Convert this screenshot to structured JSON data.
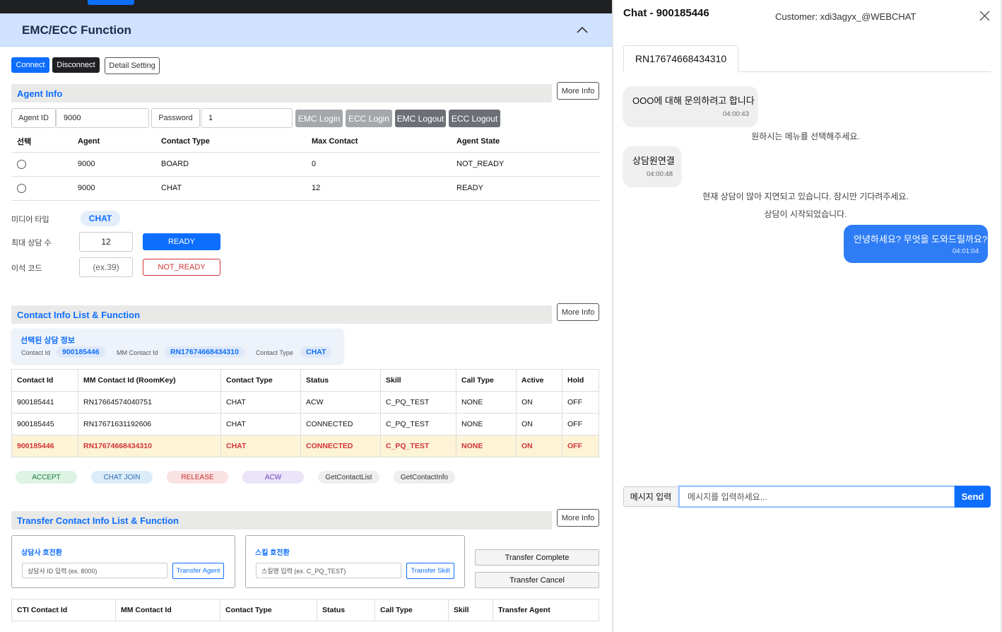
{
  "header": {
    "title": "EMC/ECC Function"
  },
  "connection": {
    "connect": "Connect",
    "disconnect": "Disconnect",
    "detail_setting": "Detail Setting"
  },
  "more_info": "More Info",
  "agent_info": {
    "title": "Agent Info",
    "agent_id_label": "Agent ID",
    "agent_id_value": "9000",
    "password_label": "Password",
    "password_value": "1",
    "buttons": {
      "emc_login": "EMC Login",
      "ecc_login": "ECC Login",
      "emc_logout": "EMC Logout",
      "ecc_logout": "ECC Logout"
    },
    "columns": [
      "선택",
      "Agent",
      "Contact Type",
      "Max Contact",
      "Agent State"
    ],
    "rows": [
      {
        "agent": "9000",
        "contact_type": "BOARD",
        "max_contact": "0",
        "state": "NOT_READY"
      },
      {
        "agent": "9000",
        "contact_type": "CHAT",
        "max_contact": "12",
        "state": "READY"
      }
    ]
  },
  "controls": {
    "media_type_label": "미디어 타입",
    "media_type_value": "CHAT",
    "max_consult_label": "최대 상담 수",
    "max_consult_value": "12",
    "ready_button": "READY",
    "away_code_label": "이석 코드",
    "away_code_placeholder": "(ex.39)",
    "not_ready_button": "NOT_READY"
  },
  "contact_info": {
    "title": "Contact Info List & Function",
    "selected": {
      "title": "선택된 상담 정보",
      "contact_id_label": "Contact Id",
      "contact_id": "900185446",
      "mm_contact_id_label": "MM Contact Id",
      "mm_contact_id": "RN17674668434310",
      "contact_type_label": "Contact Type",
      "contact_type": "CHAT"
    },
    "columns": [
      "Contact Id",
      "MM Contact Id (RoomKey)",
      "Contact Type",
      "Status",
      "Skill",
      "Call Type",
      "Active",
      "Hold"
    ],
    "rows": [
      {
        "id": "900185441",
        "mm": "RN17664574040751",
        "type": "CHAT",
        "status": "ACW",
        "skill": "C_PQ_TEST",
        "call": "NONE",
        "active": "ON",
        "hold": "OFF"
      },
      {
        "id": "900185445",
        "mm": "RN17671631192606",
        "type": "CHAT",
        "status": "CONNECTED",
        "skill": "C_PQ_TEST",
        "call": "NONE",
        "active": "ON",
        "hold": "OFF"
      },
      {
        "id": "900185446",
        "mm": "RN17674668434310",
        "type": "CHAT",
        "status": "CONNECTED",
        "skill": "C_PQ_TEST",
        "call": "NONE",
        "active": "ON",
        "hold": "OFF"
      }
    ],
    "actions": [
      "ACCEPT",
      "CHAT JOIN",
      "RELEASE",
      "ACW",
      "GetContactList",
      "GetContactInfo"
    ]
  },
  "transfer": {
    "title": "Transfer Contact Info List & Function",
    "agent_box": {
      "title": "상담사 호전환",
      "placeholder": "상담사 ID 입력 (ex. 8000)",
      "button": "Transfer Agent"
    },
    "skill_box": {
      "title": "스킬 호전환",
      "placeholder": "스킬명 입력 (ex. C_PQ_TEST)",
      "button": "Transfer Skill"
    },
    "complete": "Transfer Complete",
    "cancel": "Transfer Cancel",
    "columns": [
      "CTI Contact Id",
      "MM Contact Id",
      "Contact Type",
      "Status",
      "Call Type",
      "Skill",
      "Transfer Agent"
    ]
  },
  "chat": {
    "title": "Chat - 900185446",
    "customer": "Customer: xdi3agyx_@WEBCHAT",
    "tab": "RN17674668434310",
    "messages": {
      "m1_text": "OOO에 대해 문의하려고 합니다",
      "m1_time": "04:00:43",
      "sys1": "원하시는 메뉴를 선택해주세요.",
      "m2_text": "상담원연결",
      "m2_time": "04:00:48",
      "sys2": "현재 상담이 많아 지연되고 있습니다. 잠시만 기다려주세요.",
      "sys3": "상담이 시작되었습니다.",
      "m3_text": "안녕하세요? 무엇을 도와드릴까요?",
      "m3_time": "04:01:04"
    },
    "input_label": "메시지 입력",
    "input_placeholder": "메시지를 입력하세요...",
    "send": "Send"
  },
  "colors": {
    "accent": "#0d6efd",
    "header_bg": "#cfe2ff",
    "highlight_row": "#fdf3d7",
    "highlight_text": "#d13438"
  },
  "icons": {
    "collapse": "chevron-up-icon",
    "close": "close-icon"
  }
}
